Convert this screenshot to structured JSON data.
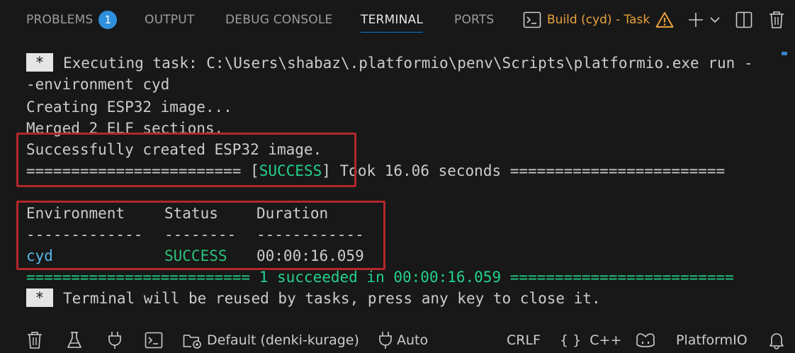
{
  "tabs": [
    {
      "label": "PROBLEMS",
      "badge": "1"
    },
    {
      "label": "OUTPUT"
    },
    {
      "label": "DEBUG CONSOLE"
    },
    {
      "label": "TERMINAL",
      "active": true
    },
    {
      "label": "PORTS"
    }
  ],
  "task": {
    "label": "Build (cyd) - Task"
  },
  "terminal": {
    "star": "*",
    "exec_line1": "Executing task: C:\\Users\\shabaz\\.platformio\\penv\\Scripts\\platformio.exe run -",
    "exec_line2": "-environment cyd",
    "creating": "Creating ESP32 image...",
    "merged": "Merged 2 ELF sections.",
    "created": "Successfully created ESP32 image.",
    "summary_prefix": "======================== [",
    "summary_status": "SUCCESS",
    "summary_suffix": "] Took 16.06 seconds ========================",
    "table": {
      "headers": [
        "Environment",
        "Status",
        "Duration"
      ],
      "dashes": [
        "-------------",
        "--------",
        "------------"
      ],
      "row": {
        "env": "cyd",
        "status": "SUCCESS",
        "duration": "00:00:16.059"
      }
    },
    "final_line": "========================= 1 succeeded in 00:00:16.059 =========================",
    "reuse_msg": "Terminal will be reused by tasks, press any key to close it."
  },
  "statusbar": {
    "profile": "Default (denki-kurage)",
    "auto": "Auto",
    "eol": "CRLF",
    "language_braces": "{ }",
    "language": "C++",
    "platform": "PlatformIO"
  },
  "colors": {
    "background": "#181818",
    "accent": "#0078d4",
    "badge": "#2f8fdd",
    "warning": "#e9a13b",
    "success": "#23d18b",
    "highlight_box": "#b2272b"
  }
}
